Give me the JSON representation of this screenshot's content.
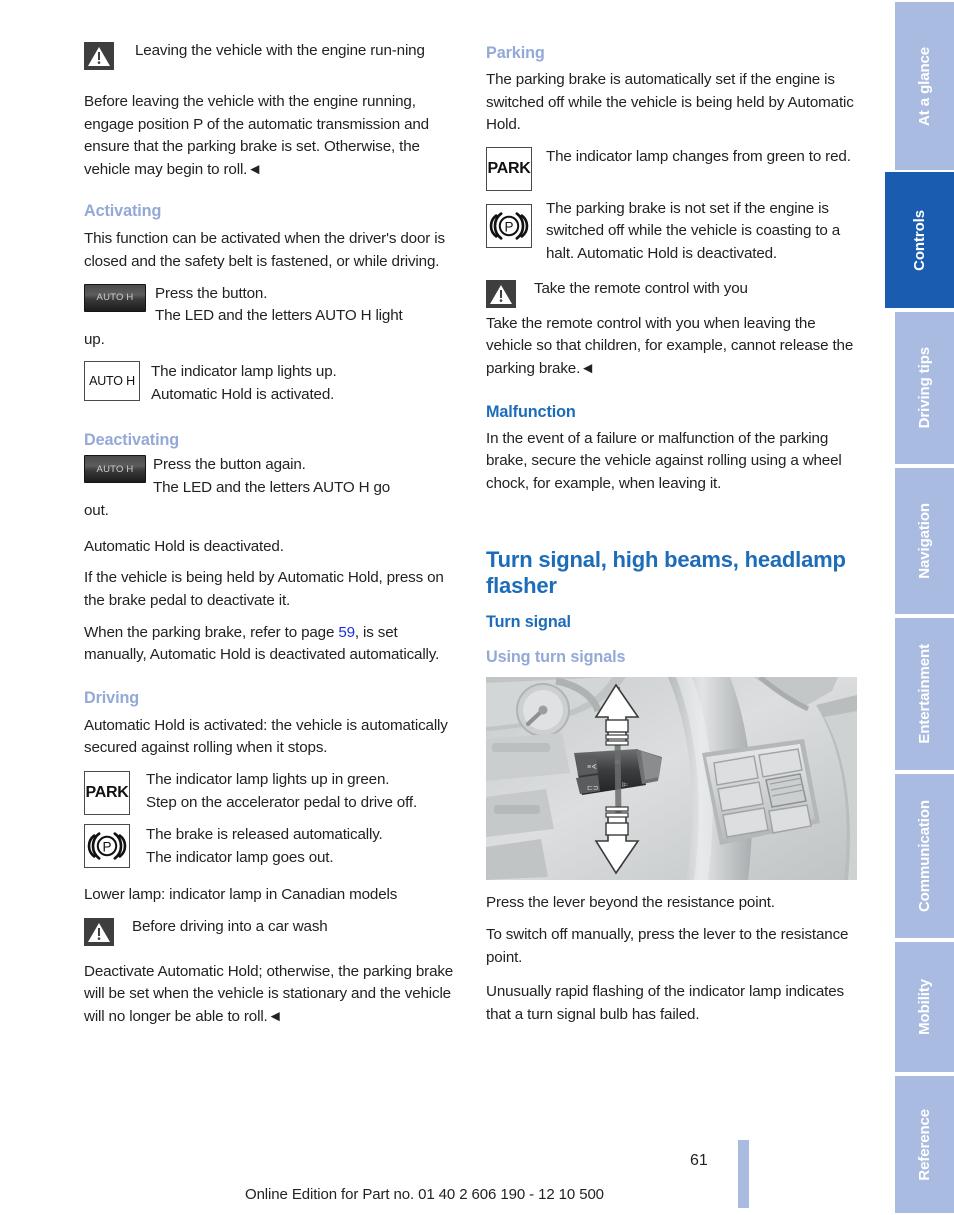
{
  "document": {
    "page_number": "61",
    "footer_note": "Online Edition for Part no. 01 40 2 606 190 - 12 10 500"
  },
  "sidebar": {
    "tabs": [
      {
        "label": "At a glance",
        "active": false
      },
      {
        "label": "Controls",
        "active": true
      },
      {
        "label": "Driving tips",
        "active": false
      },
      {
        "label": "Navigation",
        "active": false
      },
      {
        "label": "Entertainment",
        "active": false
      },
      {
        "label": "Communication",
        "active": false
      },
      {
        "label": "Mobility",
        "active": false
      },
      {
        "label": "Reference",
        "active": false
      }
    ],
    "active_color": "#1a5cb0",
    "inactive_color": "#a9bbe0"
  },
  "left_column": {
    "warning_engine_running": {
      "icon": "warning-triangle-icon",
      "title": "Leaving the vehicle with the engine run-ning",
      "body": "Before leaving the vehicle with the engine running, engage position P of the automatic transmission and ensure that the parking brake is set. Otherwise, the vehicle may begin to roll.◄"
    },
    "activating": {
      "heading": "Activating",
      "intro": "This function can be activated when the driver's door is closed and the safety belt is fastened, or while driving.",
      "button_icon_label": "AUTO H",
      "press_button": "Press the button.",
      "led_note": "The LED and the letters AUTO H light",
      "led_note_cont": "up.",
      "lamp_icon_label": "AUTO H",
      "lamp_lights": "The indicator lamp lights up.",
      "hold_activated": "Automatic Hold is activated."
    },
    "deactivating": {
      "heading": "Deactivating",
      "button_icon_label": "AUTO H",
      "press_button": "Press the button again.",
      "led_note": "The LED and the letters AUTO H go",
      "led_note_cont": "out.",
      "hold_deactivated": "Automatic Hold is deactivated.",
      "brake_pedal": "If the vehicle is being held by Automatic Hold, press on the brake pedal to deactivate it.",
      "manual_set_prefix": "When the parking brake, refer to page ",
      "manual_set_link": "59",
      "manual_set_suffix": ", is set manually, Automatic Hold is deactivated automatically."
    },
    "driving": {
      "heading": "Driving",
      "intro": "Automatic Hold is activated: the vehicle is automatically secured against rolling when it stops.",
      "park_icon_label": "PARK",
      "lamp_green": "The indicator lamp lights up in green.",
      "accelerator": "Step on the accelerator pedal to drive off.",
      "brake_icon": "parking-brake-p-icon",
      "brake_released": "The brake is released automatically.",
      "lamp_out": "The indicator lamp goes out.",
      "lower_lamp": "Lower lamp: indicator lamp in Canadian models"
    },
    "warning_car_wash": {
      "icon": "warning-triangle-icon",
      "title": "Before driving into a car wash",
      "body": "Deactivate Automatic Hold; otherwise, the parking brake will be set when the vehicle is stationary and the vehicle will no longer be able to roll.◄"
    }
  },
  "right_column": {
    "parking": {
      "heading": "Parking",
      "intro": "The parking brake is automatically set if the engine is switched off while the vehicle is being held by Automatic Hold.",
      "park_icon_label": "PARK",
      "lamp_change": "The indicator lamp changes from green to red.",
      "brake_icon": "parking-brake-p-icon",
      "not_set": "The parking brake is not set if the engine is switched off while the vehicle is coasting to a halt. Automatic Hold is deactivated."
    },
    "warning_remote": {
      "icon": "warning-triangle-icon",
      "title": "Take the remote control with you",
      "body": "Take the remote control with you when leaving the vehicle so that children, for example, cannot release the parking brake.◄"
    },
    "malfunction": {
      "heading": "Malfunction",
      "body": "In the event of a failure or malfunction of the parking brake, secure the vehicle against rolling using a wheel chock, for example, when leaving it."
    },
    "turn_signal_section": {
      "heading": "Turn signal, high beams, headlamp flasher",
      "subheading": "Turn signal",
      "sub_subheading": "Using turn signals",
      "image_caption": "steering-column-turn-signal-stalk-photo",
      "body_1": "Press the lever beyond the resistance point.",
      "body_2": "To switch off manually, press the lever to the resistance point.",
      "body_3": "Unusually rapid flashing of the indicator lamp indicates that a turn signal bulb has failed."
    }
  }
}
